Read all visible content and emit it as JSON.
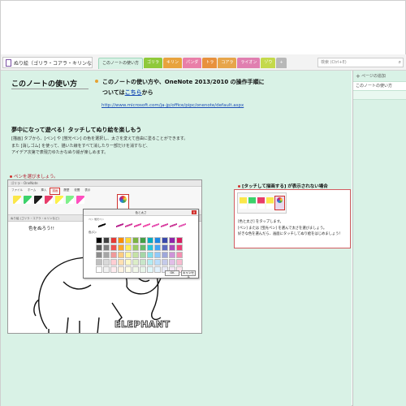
{
  "notebook": {
    "name": "ぬり絵（ゴリラ・コアラ・キリンなど）"
  },
  "tabs": [
    {
      "label": "このノートの使い方",
      "color": "#d9f2e6",
      "active": true
    },
    {
      "label": "ゴリラ",
      "color": "#8fc93a"
    },
    {
      "label": "キリン",
      "color": "#e8a33d"
    },
    {
      "label": "パンダ",
      "color": "#e97fa8"
    },
    {
      "label": "トラ",
      "color": "#e8913d"
    },
    {
      "label": "コアラ",
      "color": "#e7a54b"
    },
    {
      "label": "ライオン",
      "color": "#e07fb0"
    },
    {
      "label": "ゾウ",
      "color": "#c4d94b"
    },
    {
      "label": "+",
      "color": "#b8b8b8"
    }
  ],
  "search": {
    "placeholder": "検索 (Ctrl+E)"
  },
  "sidebar": {
    "add_page": "ページの追加",
    "pages": [
      {
        "label": "このノートの使い方"
      },
      {
        "label": ""
      }
    ]
  },
  "content": {
    "title": "このノートの使い方",
    "bullet_text_1": "このノートの使い方や、OneNote 2013/2010 の操作手順に",
    "bullet_text_2a": "ついては",
    "bullet_link": "こちら",
    "bullet_text_2b": "から",
    "url": "http://www.microsoft.com/ja-jp/office/pipc/onenote/default.aspx",
    "subtitle": "夢中になって遊べる！タッチしてぬり絵を楽しもう",
    "desc_1": "[描画] タブから、[ペン] や [蛍光ペン] の色を選択し、太さを変えて自由に塗ることができます。",
    "desc_2": "また [消しゴム] を使って、描いた線をすべて消したり一部だけを消すなど、",
    "desc_3": "アイデア次第で表現力ゆたかなぬり絵が楽しめます。",
    "pen_note": "ペンを選びましょう。"
  },
  "screenshot": {
    "window_title": "ゴリラ - OneNote",
    "ribbon_tabs": [
      "ファイル",
      "ホーム",
      "挿入",
      "描画",
      "履歴",
      "校閲",
      "表示"
    ],
    "highlighted_tab": "描画",
    "section_tabs": "ぬり絵 (ゴリラ・コアラ・キリンなど)",
    "color_label": "色をぬろう!!",
    "word": "ELEPHANT",
    "pens": [
      "#fbe74a",
      "#3cd26b",
      "#1c1c1c",
      "#e83c6a",
      "#fdf14a",
      "#7ef08a",
      "#ff4fbf"
    ]
  },
  "dialog": {
    "title": "色と太さ",
    "mode": "ペン  蛍光ペン",
    "label": "色(C):",
    "ok": "OK",
    "cancel": "キャンセル",
    "pens": [
      "#000000",
      "#ffffff",
      "#b61e8b",
      "#d13b9b",
      "#e23ca0",
      "#f04aa9",
      "#e64eb0",
      "#d83fa0",
      "#c93896",
      "#e357b2"
    ],
    "swatches": [
      "#000000",
      "#404040",
      "#e53935",
      "#fb8c00",
      "#fdd835",
      "#7cb342",
      "#43a047",
      "#00acc1",
      "#1e88e5",
      "#3949ab",
      "#8e24aa",
      "#d81b60",
      "#595959",
      "#7f7f7f",
      "#ef5350",
      "#ffa726",
      "#ffee58",
      "#9ccc65",
      "#66bb6a",
      "#26c6da",
      "#42a5f5",
      "#5c6bc0",
      "#ab47bc",
      "#ec407a",
      "#8c8c8c",
      "#a6a6a6",
      "#ef9a9a",
      "#ffcc80",
      "#fff59d",
      "#c5e1a5",
      "#a5d6a7",
      "#80deea",
      "#90caf9",
      "#9fa8da",
      "#ce93d8",
      "#f48fb1",
      "#bfbfbf",
      "#d9d9d9",
      "#ffcdd2",
      "#ffe0b2",
      "#fff9c4",
      "#dcedc8",
      "#c8e6c9",
      "#b2ebf2",
      "#bbdefb",
      "#c5cae9",
      "#e1bee7",
      "#f8bbd0",
      "#ffffff",
      "#f2f2f2",
      "#ffebee",
      "#fff3e0",
      "#fffde7",
      "#f1f8e9",
      "#e8f5e9",
      "#e0f7fa",
      "#e3f2fd",
      "#e8eaf6",
      "#f3e5f5",
      "#fce4ec"
    ]
  },
  "callout": {
    "title": "[タッチして描画する] が表示されない場合",
    "line_1": "[色と太さ] をタップします。",
    "line_2": "[ペン] または [蛍光ペン] を選んで太さを選びましょう。",
    "line_3": "好きな色を選んだら、画面にタッチしてぬり絵をはじめましょう！",
    "pens": [
      "#fbe74a",
      "#3cd26b",
      "#e83c6a",
      "#fbe74a",
      "#7ef08a"
    ]
  }
}
